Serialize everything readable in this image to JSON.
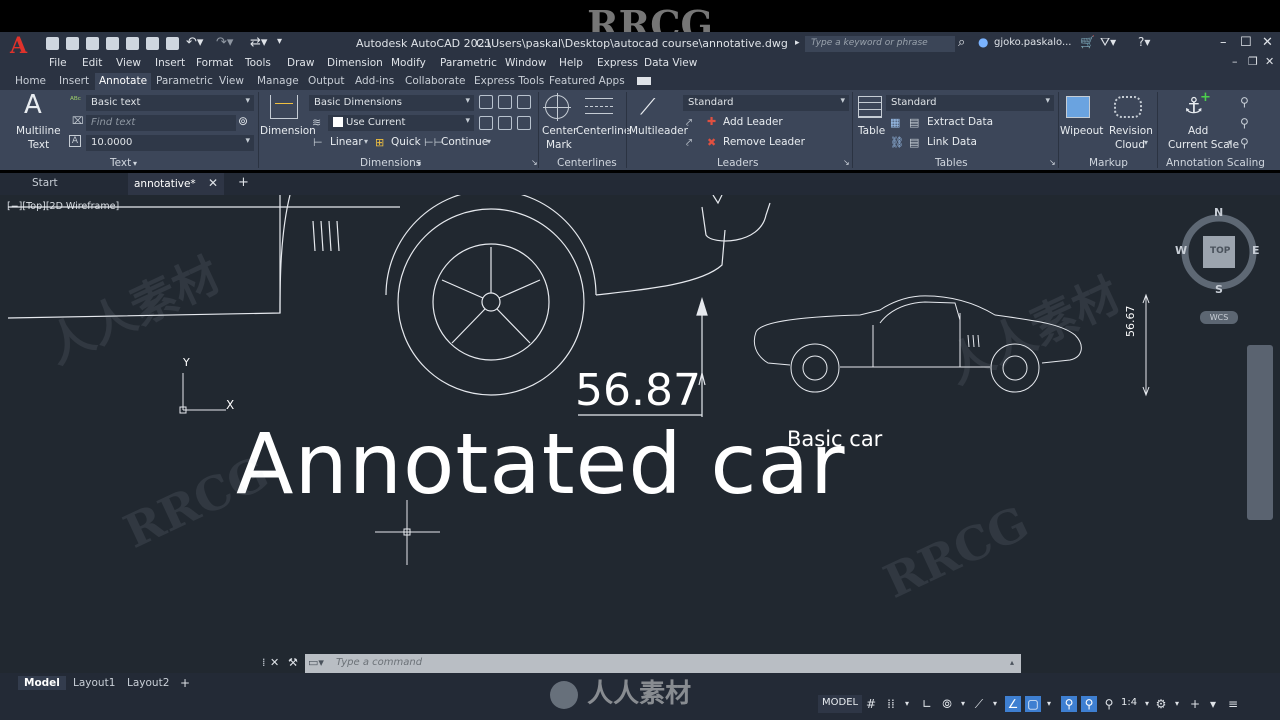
{
  "watermark_top": "RRCG",
  "title_bar": {
    "app_title": "Autodesk AutoCAD 2021",
    "file_path": "C:\\Users\\paskal\\Desktop\\autocad course\\annotative.dwg",
    "search_placeholder": "Type a keyword or phrase",
    "user": "gjoko.paskalo..."
  },
  "menu": [
    "File",
    "Edit",
    "View",
    "Insert",
    "Format",
    "Tools",
    "Draw",
    "Dimension",
    "Modify",
    "Parametric",
    "Window",
    "Help",
    "Express",
    "Data View"
  ],
  "ribbon_tabs": [
    "Home",
    "Insert",
    "Annotate",
    "Parametric",
    "View",
    "Manage",
    "Output",
    "Add-ins",
    "Collaborate",
    "Express Tools",
    "Featured Apps"
  ],
  "active_ribbon_tab": "Annotate",
  "ribbon": {
    "text": {
      "multiline_l1": "Multiline",
      "multiline_l2": "Text",
      "text_style": "Basic text",
      "find_placeholder": "Find text",
      "text_height": "10.0000",
      "panel": "Text"
    },
    "dimensions": {
      "dimension_label": "Dimension",
      "dim_style": "Basic Dimensions",
      "layer": "Use Current",
      "linear": "Linear",
      "quick": "Quick",
      "continue": "Continue",
      "panel": "Dimensions"
    },
    "centerlines": {
      "center_mark_l1": "Center",
      "center_mark_l2": "Mark",
      "centerline": "Centerline",
      "panel": "Centerlines"
    },
    "leaders": {
      "multileader": "Multileader",
      "style": "Standard",
      "add_leader": "Add Leader",
      "remove_leader": "Remove Leader",
      "panel": "Leaders"
    },
    "tables": {
      "table": "Table",
      "style": "Standard",
      "extract_data": "Extract Data",
      "link_data": "Link Data",
      "panel": "Tables"
    },
    "markup": {
      "wipeout": "Wipeout",
      "revision_cloud_l1": "Revision",
      "revision_cloud_l2": "Cloud",
      "panel": "Markup"
    },
    "scaling": {
      "add_scale_l1": "Add",
      "add_scale_l2": "Current Scale",
      "panel": "Annotation Scaling"
    }
  },
  "file_tabs": {
    "start": "Start",
    "active": "annotative*"
  },
  "viewport_label": "[−][Top][2D Wireframe]",
  "drawing": {
    "dim_large": "56.87",
    "dim_small": "56.67",
    "title_text": "Annotated car",
    "subtitle_text": "Basic car",
    "ucs_x": "X",
    "ucs_y": "Y"
  },
  "viewcube": {
    "n": "N",
    "s": "S",
    "e": "E",
    "w": "W",
    "top": "TOP",
    "wcs": "WCS"
  },
  "command_line": {
    "placeholder": "Type a command"
  },
  "layout_tabs": [
    "Model",
    "Layout1",
    "Layout2"
  ],
  "status": {
    "model": "MODEL",
    "scale": "1:4"
  },
  "watermark_bottom": "人人素材"
}
